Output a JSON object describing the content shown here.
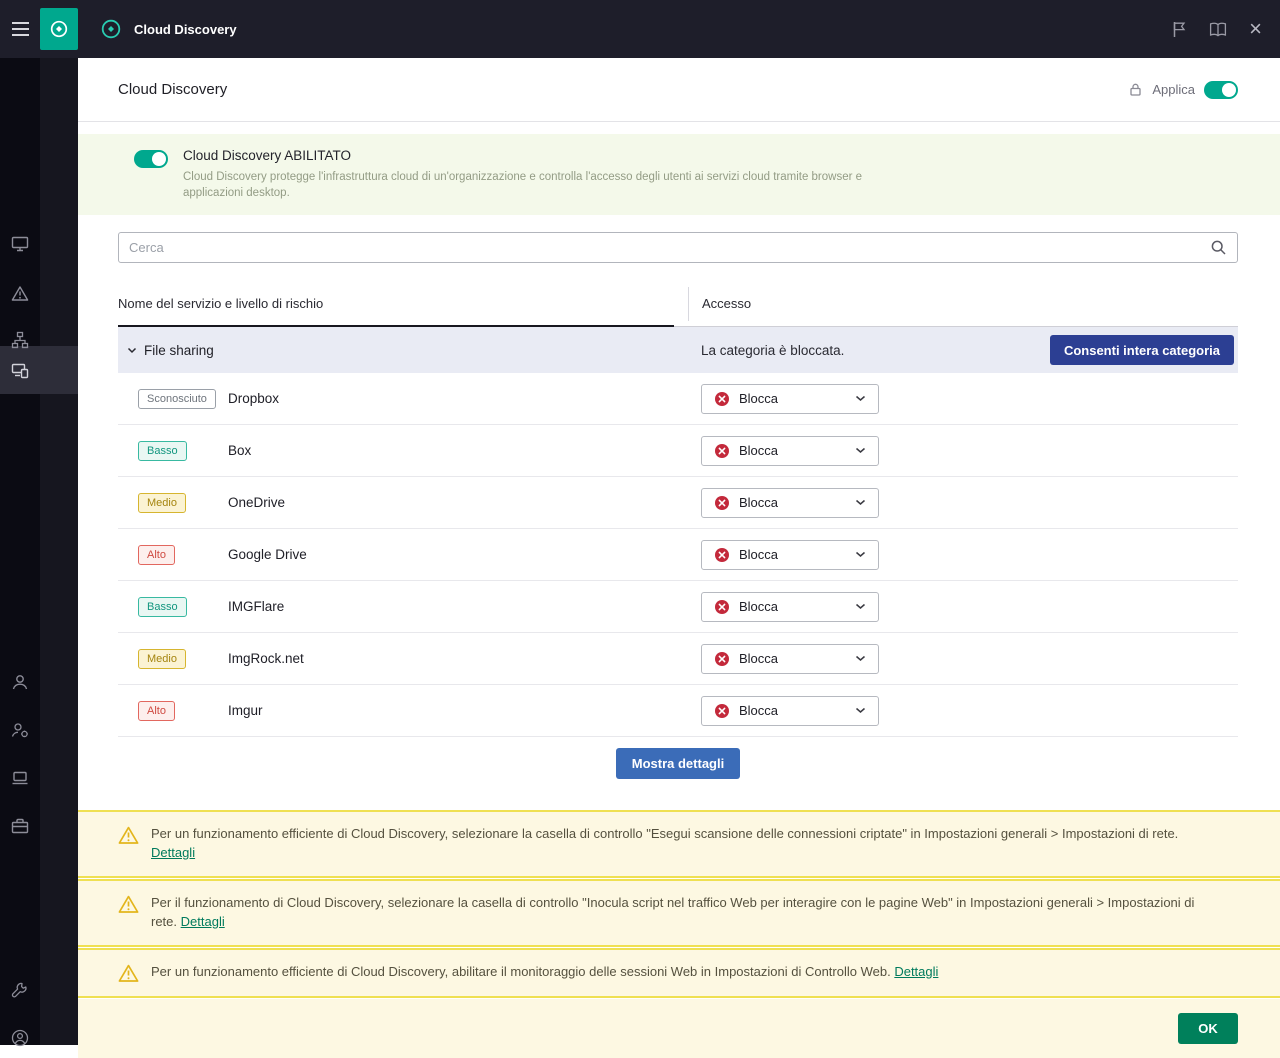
{
  "topbar": {
    "title": "Cloud Discovery"
  },
  "header": {
    "title": "Cloud Discovery",
    "apply_label": "Applica",
    "apply_enabled": true
  },
  "banner": {
    "title": "Cloud Discovery ABILITATO",
    "enabled": true,
    "description": "Cloud Discovery protegge l'infrastruttura cloud di un'organizzazione e controlla l'accesso degli utenti ai servizi cloud tramite browser e applicazioni desktop."
  },
  "search": {
    "placeholder": "Cerca"
  },
  "table": {
    "columns": {
      "name": "Nome del servizio e livello di rischio",
      "access": "Accesso"
    },
    "category": {
      "name": "File sharing",
      "status": "La categoria è bloccata.",
      "action_label": "Consenti intera categoria"
    },
    "rows": [
      {
        "risk": "Sconosciuto",
        "level": "unknown",
        "service": "Dropbox",
        "access": "Blocca"
      },
      {
        "risk": "Basso",
        "level": "low",
        "service": "Box",
        "access": "Blocca"
      },
      {
        "risk": "Medio",
        "level": "medium",
        "service": "OneDrive",
        "access": "Blocca"
      },
      {
        "risk": "Alto",
        "level": "high",
        "service": "Google Drive",
        "access": "Blocca"
      },
      {
        "risk": "Basso",
        "level": "low",
        "service": "IMGFlare",
        "access": "Blocca"
      },
      {
        "risk": "Medio",
        "level": "medium",
        "service": "ImgRock.net",
        "access": "Blocca"
      },
      {
        "risk": "Alto",
        "level": "high",
        "service": "Imgur",
        "access": "Blocca"
      }
    ],
    "show_details_label": "Mostra dettagli"
  },
  "warnings": [
    {
      "text": "Per un funzionamento efficiente di Cloud Discovery, selezionare la casella di controllo \"Esegui scansione delle connessioni criptate\" in Impostazioni generali > Impostazioni di rete.",
      "link": "Dettagli"
    },
    {
      "text": "Per il funzionamento di Cloud Discovery, selezionare la casella di controllo \"Inocula script nel traffico Web per interagire con le pagine Web\" in Impostazioni generali > Impostazioni di rete.",
      "link": "Dettagli"
    },
    {
      "text": "Per un funzionamento efficiente di Cloud Discovery, abilitare il monitoraggio delle sessioni Web in Impostazioni di Controllo Web.",
      "link": "Dettagli"
    }
  ],
  "footer": {
    "ok_label": "OK"
  },
  "colors": {
    "accent_green": "#00a88e",
    "blocked_red": "#c3293b",
    "category_button_blue": "#2c3f93",
    "details_button_blue": "#3b6cb8",
    "ok_button_green": "#00805b",
    "warning_yellow": "#efe052",
    "banner_green_bg": "#f4f9ea",
    "warning_bg": "#fdf8e2",
    "topbar_bg": "#1e1e2a"
  },
  "icons": {
    "menu": "hamburger",
    "logo": "kaspersky-circle",
    "flag": "flag",
    "help_book": "book",
    "close": "×",
    "lock": "lock",
    "search": "magnifier",
    "warning": "triangle-exclamation",
    "block": "circle-x",
    "chevron_down": "v"
  }
}
